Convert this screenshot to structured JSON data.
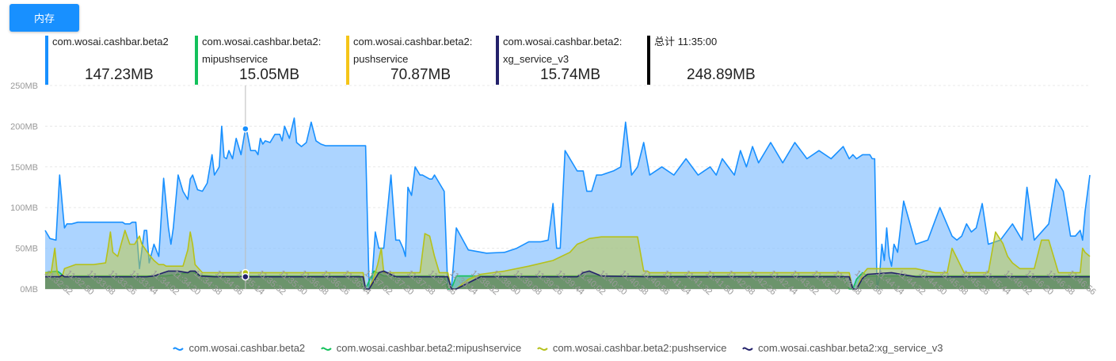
{
  "button": {
    "label": "内存"
  },
  "stats": [
    {
      "name": "com.wosai.cashbar.beta2",
      "value": "147.23MB",
      "color": "#1890ff"
    },
    {
      "name": "com.wosai.cashbar.beta2:\nmipushservice",
      "value": "15.05MB",
      "color": "#13c15b"
    },
    {
      "name": "com.wosai.cashbar.beta2:\npushservice",
      "value": "70.87MB",
      "color": "#f5c518"
    },
    {
      "name": "com.wosai.cashbar.beta2:\nxg_service_v3",
      "value": "15.74MB",
      "color": "#23216b"
    },
    {
      "name": "总计 11:35:00",
      "value": "248.89MB",
      "color": "#000000"
    }
  ],
  "chart_data": {
    "type": "area",
    "ylabel": "",
    "ylim": [
      0,
      250
    ],
    "y_ticks": [
      "0MB",
      "50MB",
      "100MB",
      "150MB",
      "200MB",
      "250MB"
    ],
    "x_ticks": [
      "11:32:32",
      "11:32:50",
      "11:33:08",
      "11:33:26",
      "11:33:44",
      "11:34:02",
      "11:34:20",
      "11:34:38",
      "11:34:56",
      "11:35:14",
      "11:35:32",
      "11:35:50",
      "11:36:08",
      "11:36:26",
      "11:36:44",
      "11:37:02",
      "11:37:20",
      "11:37:38",
      "11:37:56",
      "11:38:14",
      "11:38:32",
      "11:38:50",
      "11:39:08",
      "11:39:26",
      "11:39:44",
      "11:40:02",
      "11:40:20",
      "11:40:38",
      "11:40:56",
      "11:41:14",
      "11:41:32",
      "11:41:50",
      "11:42:08",
      "11:42:26",
      "11:42:44",
      "11:43:02",
      "11:43:20",
      "11:43:38",
      "11:43:56",
      "11:44:14",
      "11:44:32",
      "11:44:50",
      "11:45:08",
      "11:45:26",
      "11:45:44",
      "11:46:02",
      "11:46:20",
      "11:46:38",
      "11:46:56"
    ],
    "x_range_seconds": [
      0,
      864
    ],
    "grid": true,
    "legend_position": "bottom",
    "hover": {
      "time": "11:35:00",
      "series_index": [
        0,
        2,
        3
      ]
    },
    "series": [
      {
        "name": "com.wosai.cashbar.beta2",
        "color": "#1890ff",
        "fill": "rgba(140,195,255,0.72)",
        "t": [
          0,
          4,
          9,
          12,
          15,
          16,
          18,
          22,
          27,
          30,
          40,
          50,
          60,
          64,
          66,
          68,
          70,
          72,
          75,
          78,
          82,
          84,
          86,
          90,
          94,
          98,
          102,
          104,
          106,
          110,
          114,
          118,
          120,
          122,
          126,
          130,
          134,
          138,
          140,
          144,
          146,
          148,
          150,
          152,
          155,
          158,
          162,
          166,
          170,
          174,
          176,
          178,
          180,
          182,
          186,
          190,
          194,
          196,
          198,
          202,
          206,
          208,
          212,
          216,
          220,
          224,
          228,
          232,
          236,
          240,
          244,
          250,
          256,
          263,
          265,
          268,
          270,
          273,
          276,
          280,
          286,
          290,
          293,
          296,
          298,
          300,
          303,
          306,
          310,
          312,
          318,
          320,
          322,
          326,
          330,
          333,
          336,
          340,
          350,
          365,
          380,
          390,
          400,
          410,
          416,
          420,
          423,
          426,
          430,
          440,
          445,
          448,
          450,
          452,
          456,
          460,
          470,
          476,
          480,
          485,
          490,
          495,
          500,
          510,
          520,
          530,
          540,
          550,
          555,
          560,
          570,
          575,
          580,
          585,
          590,
          600,
          610,
          620,
          630,
          640,
          650,
          660,
          665,
          668,
          671,
          676,
          680,
          682,
          684,
          686,
          688,
          690,
          692,
          694,
          696,
          698,
          700,
          702,
          705,
          710,
          720,
          730,
          740,
          750,
          754,
          758,
          762,
          766,
          770,
          775,
          780,
          790,
          800,
          808,
          812,
          818,
          830,
          836,
          842,
          848,
          852,
          856,
          858,
          860,
          864
        ],
        "v": [
          72,
          62,
          60,
          140,
          90,
          75,
          80,
          80,
          82,
          82,
          82,
          82,
          82,
          82,
          80,
          80,
          80,
          82,
          82,
          25,
          72,
          72,
          32,
          55,
          40,
          136,
          75,
          55,
          75,
          140,
          120,
          110,
          135,
          140,
          122,
          120,
          130,
          165,
          140,
          150,
          200,
          162,
          160,
          170,
          160,
          185,
          165,
          200,
          170,
          170,
          165,
          185,
          178,
          182,
          180,
          190,
          190,
          182,
          200,
          185,
          210,
          180,
          175,
          180,
          205,
          182,
          178,
          176,
          176,
          176,
          176,
          176,
          176,
          176,
          176,
          0,
          5,
          70,
          50,
          50,
          140,
          60,
          60,
          50,
          40,
          125,
          115,
          150,
          140,
          140,
          135,
          135,
          140,
          130,
          120,
          0,
          0,
          75,
          48,
          44,
          45,
          50,
          58,
          58,
          60,
          105,
          50,
          50,
          170,
          145,
          145,
          120,
          120,
          120,
          140,
          140,
          145,
          150,
          205,
          140,
          150,
          180,
          140,
          150,
          140,
          160,
          140,
          150,
          140,
          160,
          140,
          170,
          150,
          175,
          155,
          180,
          155,
          180,
          160,
          170,
          160,
          175,
          160,
          165,
          160,
          165,
          165,
          165,
          160,
          160,
          0,
          15,
          55,
          35,
          75,
          40,
          28,
          55,
          45,
          108,
          55,
          60,
          100,
          65,
          60,
          65,
          80,
          70,
          75,
          105,
          55,
          60,
          80,
          60,
          125,
          60,
          80,
          135,
          120,
          65,
          65,
          72,
          60,
          95,
          140,
          82,
          82,
          140,
          180,
          145,
          145,
          145,
          5,
          5,
          3
        ]
      },
      {
        "name": "com.wosai.cashbar.beta2:mipushservice",
        "color": "#13c15b",
        "fill": "rgba(60,170,100,0.45)",
        "t": [
          0,
          10,
          12,
          16,
          18,
          22,
          30,
          60,
          100,
          118,
          122,
          126,
          140,
          160,
          200,
          260,
          263,
          265,
          268,
          272,
          280,
          290,
          300,
          320,
          330,
          333,
          336,
          340,
          360,
          400,
          420,
          440,
          460,
          480,
          520,
          560,
          600,
          640,
          650,
          660,
          665,
          668,
          671,
          676,
          680,
          700,
          720,
          760,
          800,
          840,
          864
        ],
        "v": [
          20,
          22,
          20,
          15,
          15,
          16,
          16,
          16,
          16,
          20,
          22,
          17,
          16,
          16,
          16,
          16,
          0,
          0,
          10,
          22,
          16,
          16,
          16,
          16,
          16,
          0,
          0,
          16,
          16,
          16,
          16,
          16,
          16,
          16,
          16,
          16,
          16,
          16,
          16,
          16,
          0,
          0,
          12,
          20,
          16,
          16,
          16,
          16,
          16,
          16,
          16
        ]
      },
      {
        "name": "com.wosai.cashbar.beta2:pushservice",
        "color": "#b5c11a",
        "fill": "rgba(190,200,60,0.5)",
        "t": [
          0,
          5,
          8,
          10,
          12,
          14,
          16,
          25,
          40,
          50,
          52,
          54,
          56,
          60,
          66,
          70,
          74,
          76,
          78,
          80,
          86,
          90,
          94,
          98,
          100,
          114,
          118,
          120,
          122,
          124,
          130,
          140,
          150,
          160,
          200,
          245,
          263,
          265,
          268,
          272,
          275,
          278,
          280,
          286,
          300,
          310,
          314,
          318,
          322,
          326,
          333,
          336,
          340,
          350,
          360,
          380,
          400,
          420,
          434,
          440,
          445,
          450,
          460,
          490,
          495,
          498,
          500,
          502,
          504,
          506,
          510,
          560,
          600,
          640,
          660,
          665,
          668,
          671,
          676,
          680,
          700,
          720,
          736,
          740,
          742,
          744,
          746,
          750,
          760,
          776,
          780,
          786,
          792,
          796,
          800,
          806,
          812,
          818,
          824,
          830,
          838,
          846,
          856,
          858,
          860,
          864
        ],
        "v": [
          20,
          20,
          50,
          20,
          15,
          15,
          25,
          30,
          30,
          32,
          50,
          70,
          45,
          40,
          72,
          55,
          55,
          60,
          65,
          55,
          42,
          35,
          30,
          30,
          28,
          28,
          48,
          70,
          55,
          30,
          20,
          20,
          20,
          20,
          20,
          20,
          20,
          0,
          0,
          15,
          30,
          50,
          20,
          20,
          20,
          20,
          68,
          65,
          40,
          20,
          20,
          0,
          0,
          12,
          18,
          22,
          28,
          35,
          45,
          55,
          58,
          62,
          64,
          64,
          22,
          22,
          20,
          20,
          20,
          20,
          20,
          20,
          20,
          20,
          20,
          20,
          0,
          0,
          18,
          25,
          25,
          25,
          20,
          20,
          20,
          20,
          20,
          50,
          20,
          20,
          20,
          70,
          56,
          40,
          32,
          25,
          25,
          25,
          60,
          60,
          20,
          20,
          20,
          50,
          45,
          40,
          35,
          20,
          20,
          20,
          20,
          20
        ]
      },
      {
        "name": "com.wosai.cashbar.beta2:xg_service_v3",
        "color": "#23216b",
        "fill": "rgba(50,90,90,0.45)",
        "t": [
          0,
          12,
          14,
          16,
          30,
          50,
          60,
          70,
          84,
          90,
          94,
          98,
          102,
          110,
          118,
          120,
          124,
          128,
          140,
          160,
          200,
          263,
          265,
          268,
          272,
          276,
          280,
          290,
          300,
          310,
          320,
          333,
          336,
          340,
          360,
          400,
          420,
          440,
          445,
          450,
          460,
          500,
          560,
          600,
          660,
          665,
          668,
          671,
          676,
          680,
          700,
          720,
          760,
          800,
          840,
          864
        ],
        "v": [
          15,
          15,
          17,
          15,
          15,
          15,
          15,
          15,
          15,
          16,
          18,
          20,
          22,
          22,
          20,
          22,
          22,
          16,
          15,
          15,
          15,
          15,
          0,
          0,
          10,
          20,
          22,
          15,
          15,
          15,
          15,
          15,
          0,
          0,
          15,
          15,
          15,
          15,
          20,
          22,
          16,
          15,
          15,
          15,
          15,
          15,
          0,
          0,
          13,
          18,
          20,
          15,
          15,
          15,
          15,
          15
        ]
      }
    ]
  }
}
